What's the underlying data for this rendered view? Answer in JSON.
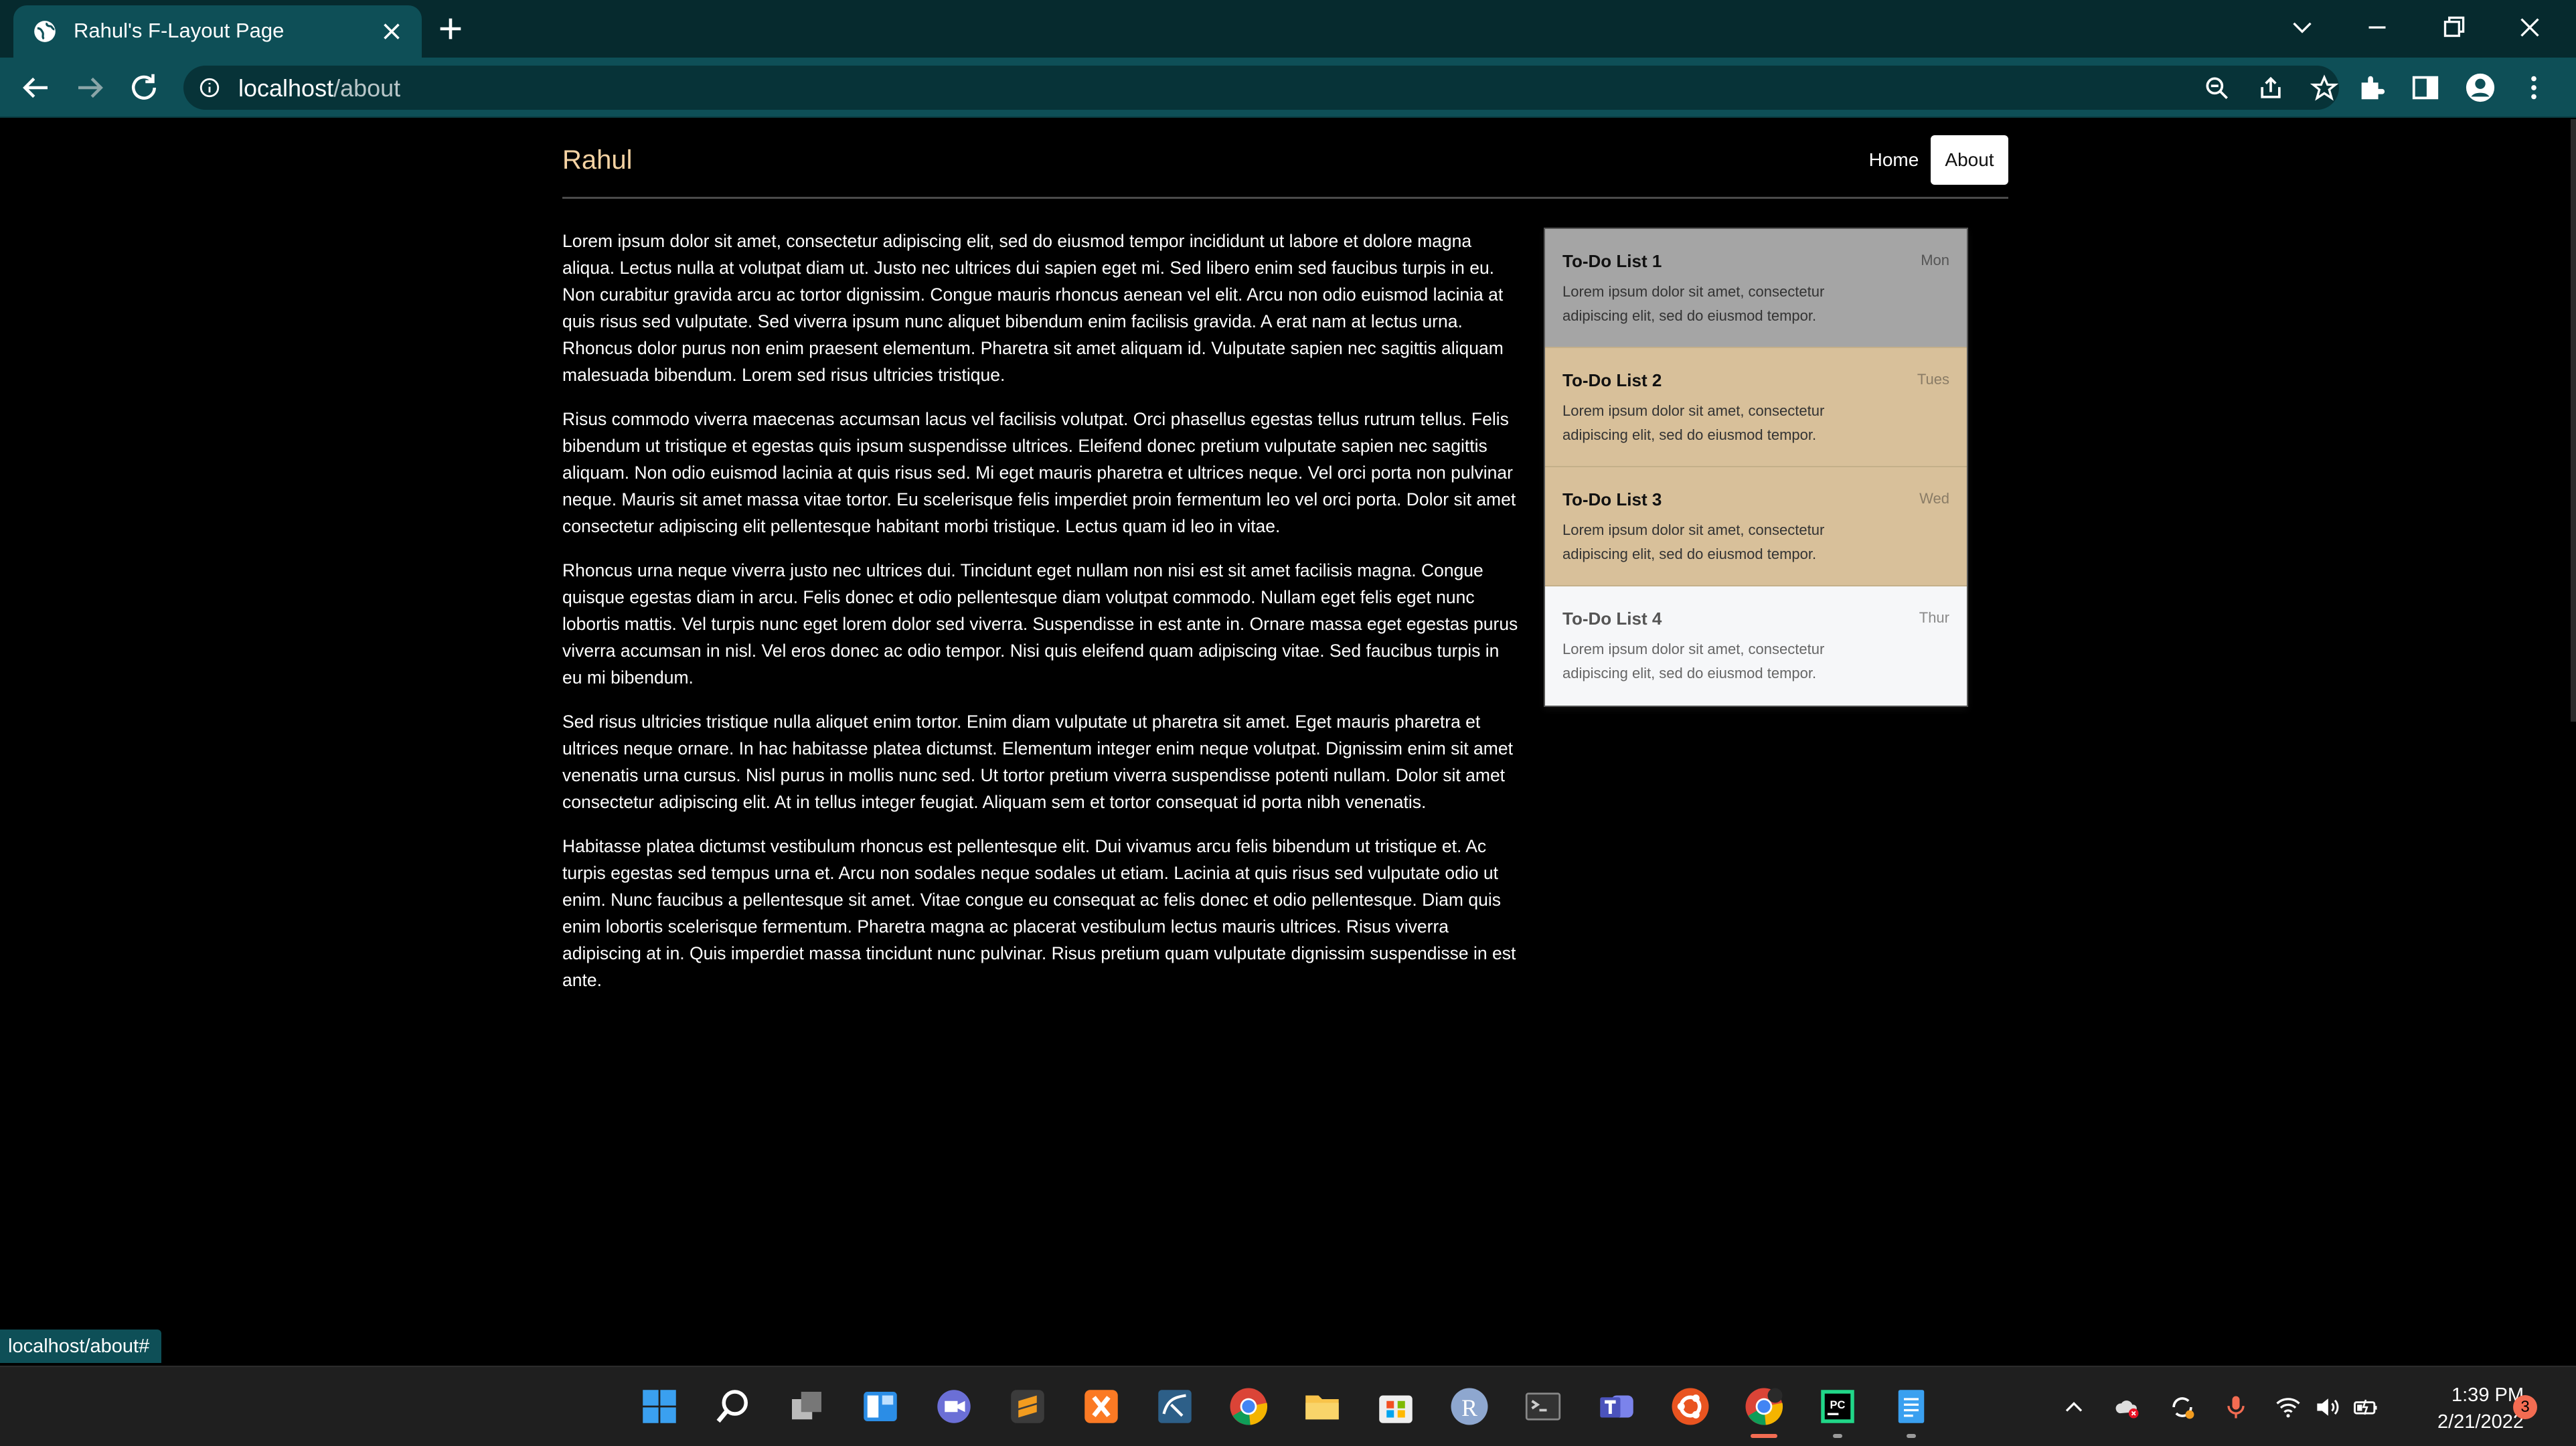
{
  "browser": {
    "tab_title": "Rahul's F-Layout Page",
    "url_host": "localhost",
    "url_path": "/about",
    "status_link": "localhost/about#"
  },
  "site": {
    "brand": "Rahul",
    "nav": {
      "home": "Home",
      "about": "About"
    }
  },
  "content": {
    "paragraphs": [
      "Lorem ipsum dolor sit amet, consectetur adipiscing elit, sed do eiusmod tempor incididunt ut labore et dolore magna aliqua. Lectus nulla at volutpat diam ut. Justo nec ultrices dui sapien eget mi. Sed libero enim sed faucibus turpis in eu. Non curabitur gravida arcu ac tortor dignissim. Congue mauris rhoncus aenean vel elit. Arcu non odio euismod lacinia at quis risus sed vulputate. Sed viverra ipsum nunc aliquet bibendum enim facilisis gravida. A erat nam at lectus urna. Rhoncus dolor purus non enim praesent elementum. Pharetra sit amet aliquam id. Vulputate sapien nec sagittis aliquam malesuada bibendum. Lorem sed risus ultricies tristique.",
      "Risus commodo viverra maecenas accumsan lacus vel facilisis volutpat. Orci phasellus egestas tellus rutrum tellus. Felis bibendum ut tristique et egestas quis ipsum suspendisse ultrices. Eleifend donec pretium vulputate sapien nec sagittis aliquam. Non odio euismod lacinia at quis risus sed. Mi eget mauris pharetra et ultrices neque. Vel orci porta non pulvinar neque. Mauris sit amet massa vitae tortor. Eu scelerisque felis imperdiet proin fermentum leo vel orci porta. Dolor sit amet consectetur adipiscing elit pellentesque habitant morbi tristique. Lectus quam id leo in vitae.",
      "Rhoncus urna neque viverra justo nec ultrices dui. Tincidunt eget nullam non nisi est sit amet facilisis magna. Congue quisque egestas diam in arcu. Felis donec et odio pellentesque diam volutpat commodo. Nullam eget felis eget nunc lobortis mattis. Vel turpis nunc eget lorem dolor sed viverra. Suspendisse in est ante in. Ornare massa eget egestas purus viverra accumsan in nisl. Vel eros donec ac odio tempor. Nisi quis eleifend quam adipiscing vitae. Sed faucibus turpis in eu mi bibendum.",
      "Sed risus ultricies tristique nulla aliquet enim tortor. Enim diam vulputate ut pharetra sit amet. Eget mauris pharetra et ultrices neque ornare. In hac habitasse platea dictumst. Elementum integer enim neque volutpat. Dignissim enim sit amet venenatis urna cursus. Nisl purus in mollis nunc sed. Ut tortor pretium viverra suspendisse potenti nullam. Dolor sit amet consectetur adipiscing elit. At in tellus integer feugiat. Aliquam sem et tortor consequat id porta nibh venenatis.",
      "Habitasse platea dictumst vestibulum rhoncus est pellentesque elit. Dui vivamus arcu felis bibendum ut tristique et. Ac turpis egestas sed tempus urna et. Arcu non sodales neque sodales ut etiam. Lacinia at quis risus sed vulputate odio ut enim. Nunc faucibus a pellentesque sit amet. Vitae congue eu consequat ac felis donec et odio pellentesque. Diam quis enim lobortis scelerisque fermentum. Pharetra magna ac placerat vestibulum lectus mauris ultrices. Risus viverra adipiscing at in. Quis imperdiet massa tincidunt nunc pulvinar. Risus pretium quam vulputate dignissim suspendisse in est ante."
    ]
  },
  "todo": [
    {
      "title": "To-Do List 1",
      "day": "Mon",
      "text": "Lorem ipsum dolor sit amet, consectetur adipiscing elit, sed do eiusmod tempor."
    },
    {
      "title": "To-Do List 2",
      "day": "Tues",
      "text": "Lorem ipsum dolor sit amet, consectetur adipiscing elit, sed do eiusmod tempor."
    },
    {
      "title": "To-Do List 3",
      "day": "Wed",
      "text": "Lorem ipsum dolor sit amet, consectetur adipiscing elit, sed do eiusmod tempor."
    },
    {
      "title": "To-Do List 4",
      "day": "Thur",
      "text": "Lorem ipsum dolor sit amet, consectetur adipiscing elit, sed do eiusmod tempor."
    }
  ],
  "taskbar": {
    "time": "1:39 PM",
    "date": "2/21/2022",
    "notification_count": "3",
    "apps": [
      "start-icon",
      "search-icon",
      "task-view-icon",
      "widgets-icon",
      "chat-icon",
      "sublime-text-icon",
      "xampp-icon",
      "mysql-workbench-icon",
      "chrome-icon",
      "file-explorer-icon",
      "microsoft-store-icon",
      "r-icon",
      "terminal-icon",
      "teams-icon",
      "ubuntu-icon",
      "chrome-profile-icon",
      "pycharm-icon",
      "notepad-icon"
    ]
  },
  "colors": {
    "accent": "#0e4f57",
    "brand": "#f5d3a3",
    "list_selected": "#a5a5a5",
    "list_item": "#d8c09a"
  }
}
